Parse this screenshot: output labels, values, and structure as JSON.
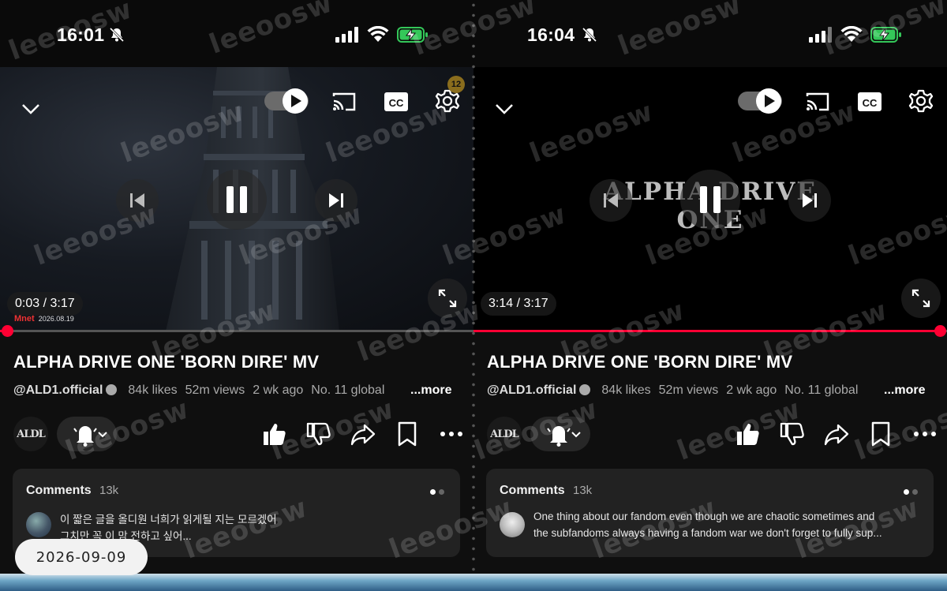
{
  "left": {
    "status": {
      "time": "16:01"
    },
    "player": {
      "elapsed_time": "0:03 / 3:17",
      "progress_fraction": 0.015,
      "settings_badge": "12",
      "channel_logo": "Mnet",
      "broadcast_date": "2026.08.19"
    },
    "video": {
      "title": "ALPHA DRIVE ONE 'BORN DIRE' MV",
      "channel_handle": "@ALD1.official",
      "likes": "84k likes",
      "views": "52m views",
      "age": "2 wk ago",
      "rank": "No. 11 global",
      "more": "...more"
    },
    "channel": {
      "avatar_text": "ALDL"
    },
    "comments": {
      "label": "Comments",
      "count": "13k",
      "line1": "이 짧은 글을 올디원 너희가 읽게될 지는 모르겠어",
      "line2": "그치만 꼭 이 맘 전하고 싶어..."
    }
  },
  "right": {
    "status": {
      "time": "16:04"
    },
    "player": {
      "elapsed_time": "3:14 / 3:17",
      "progress_fraction": 0.985,
      "art_text": "ALPHA DRIVE ONE"
    },
    "video": {
      "title": "ALPHA DRIVE ONE 'BORN DIRE' MV",
      "channel_handle": "@ALD1.official",
      "likes": "84k likes",
      "views": "52m views",
      "age": "2 wk ago",
      "rank": "No. 11 global",
      "more": "...more"
    },
    "channel": {
      "avatar_text": "ALDL"
    },
    "comments": {
      "label": "Comments",
      "count": "13k",
      "line1": "One thing about our fandom even though we are chaotic sometimes and",
      "line2": "the subfandoms always having a fandom war we don't forget to fully sup..."
    }
  },
  "date_stamp": "2026-09-09",
  "watermark": "leeoosw",
  "colors": {
    "accent": "#ff0033",
    "background": "#0f0f0f",
    "card": "#222222",
    "battery": "#34c759"
  }
}
